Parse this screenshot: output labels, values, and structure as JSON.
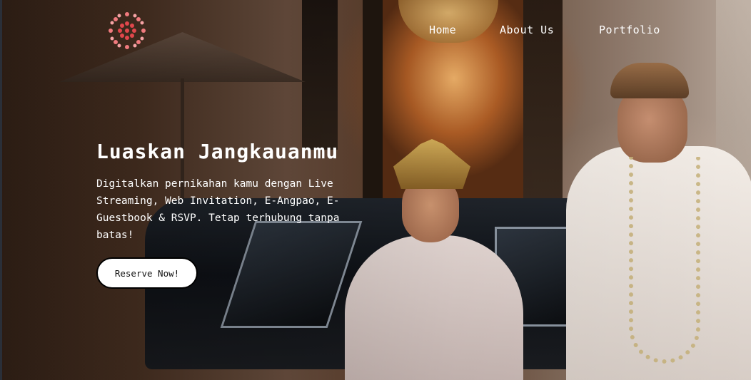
{
  "nav": {
    "logo_icon": "red-dotted-sun-logo-icon",
    "items": [
      {
        "label": "Home"
      },
      {
        "label": "About Us"
      },
      {
        "label": "Portfolio"
      }
    ]
  },
  "hero": {
    "headline": "Luaskan Jangkauanmu",
    "description": "Digitalkan pernikahan kamu dengan Live Streaming, Web Invitation, E-Angpao, E-Guestbook & RSVP. Tetap terhubung tanpa batas!",
    "cta_label": "Reserve Now!",
    "background_image": "wedding-couple-photo"
  },
  "colors": {
    "logo_red": "#e0474c",
    "text": "#ffffff",
    "button_bg": "#ffffff",
    "button_border": "#000000"
  }
}
